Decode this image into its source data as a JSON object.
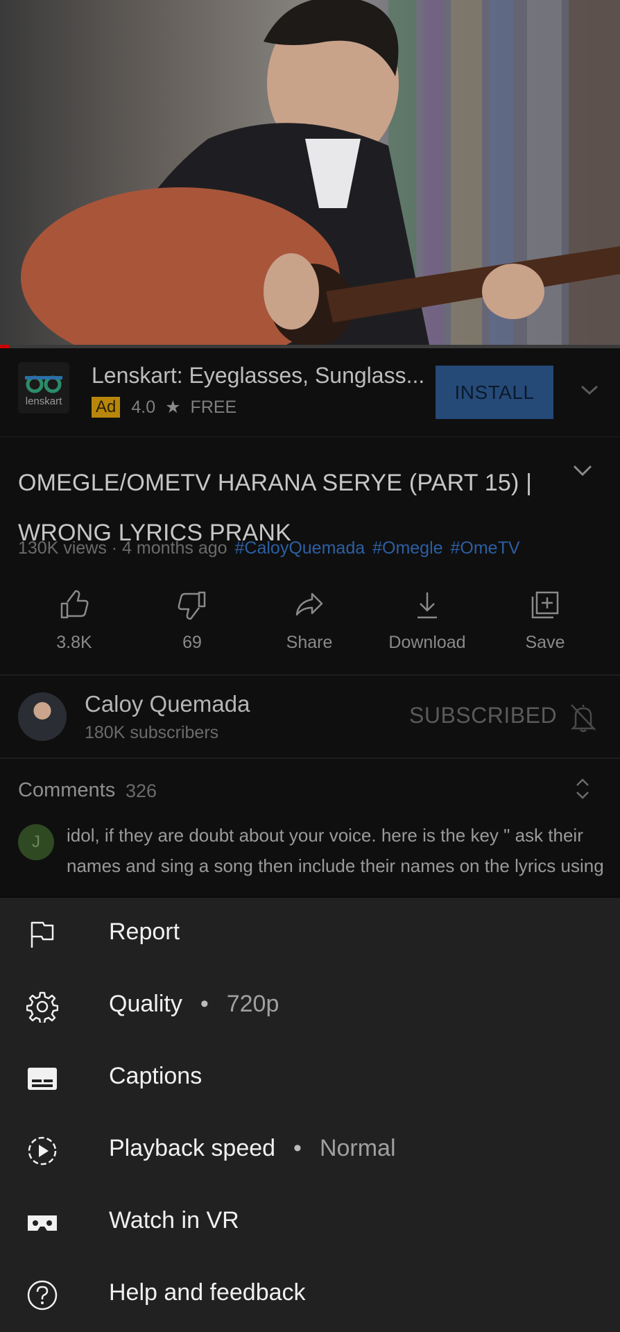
{
  "video": {
    "progress_fraction": 0.015
  },
  "ad": {
    "logo_text": "lenskart",
    "title": "Lenskart: Eyeglasses, Sunglass...",
    "badge": "Ad",
    "rating": "4.0",
    "star": "★",
    "price": "FREE",
    "install_label": "INSTALL"
  },
  "video_info": {
    "title": "OMEGLE/OMETV HARANA SERYE (PART 15) | WRONG LYRICS PRANK",
    "views_time": "130K views · 4 months ago",
    "hashtags": [
      "#CaloyQuemada",
      "#Omegle",
      "#OmeTV"
    ]
  },
  "actions": [
    {
      "label": "3.8K",
      "icon": "thumbs-up-icon"
    },
    {
      "label": "69",
      "icon": "thumbs-down-icon"
    },
    {
      "label": "Share",
      "icon": "share-icon"
    },
    {
      "label": "Download",
      "icon": "download-icon"
    },
    {
      "label": "Save",
      "icon": "save-to-playlist-icon"
    }
  ],
  "channel": {
    "name": "Caloy Quemada",
    "subscribers": "180K subscribers",
    "subscribe_state": "SUBSCRIBED"
  },
  "comments": {
    "label": "Comments",
    "count": "326",
    "avatar_letter": "J",
    "top_comment": "idol, if they are doubt about your voice. here is the key \" ask their names and sing a song then include their names on the lyrics using ..."
  },
  "menu": {
    "items": [
      {
        "label": "Report",
        "icon": "flag-icon"
      },
      {
        "label": "Quality",
        "value": "720p",
        "icon": "gear-icon"
      },
      {
        "label": "Captions",
        "icon": "captions-icon"
      },
      {
        "label": "Playback speed",
        "value": "Normal",
        "icon": "playback-speed-icon"
      },
      {
        "label": "Watch in VR",
        "icon": "vr-headset-icon"
      },
      {
        "label": "Help and feedback",
        "icon": "help-icon"
      }
    ],
    "separator": "•"
  },
  "colors": {
    "progress": "#cc0000",
    "install_button": "#254a78",
    "hashtag": "#2c5fa3",
    "ad_badge": "#b8860b",
    "sheet_background": "#212121"
  }
}
